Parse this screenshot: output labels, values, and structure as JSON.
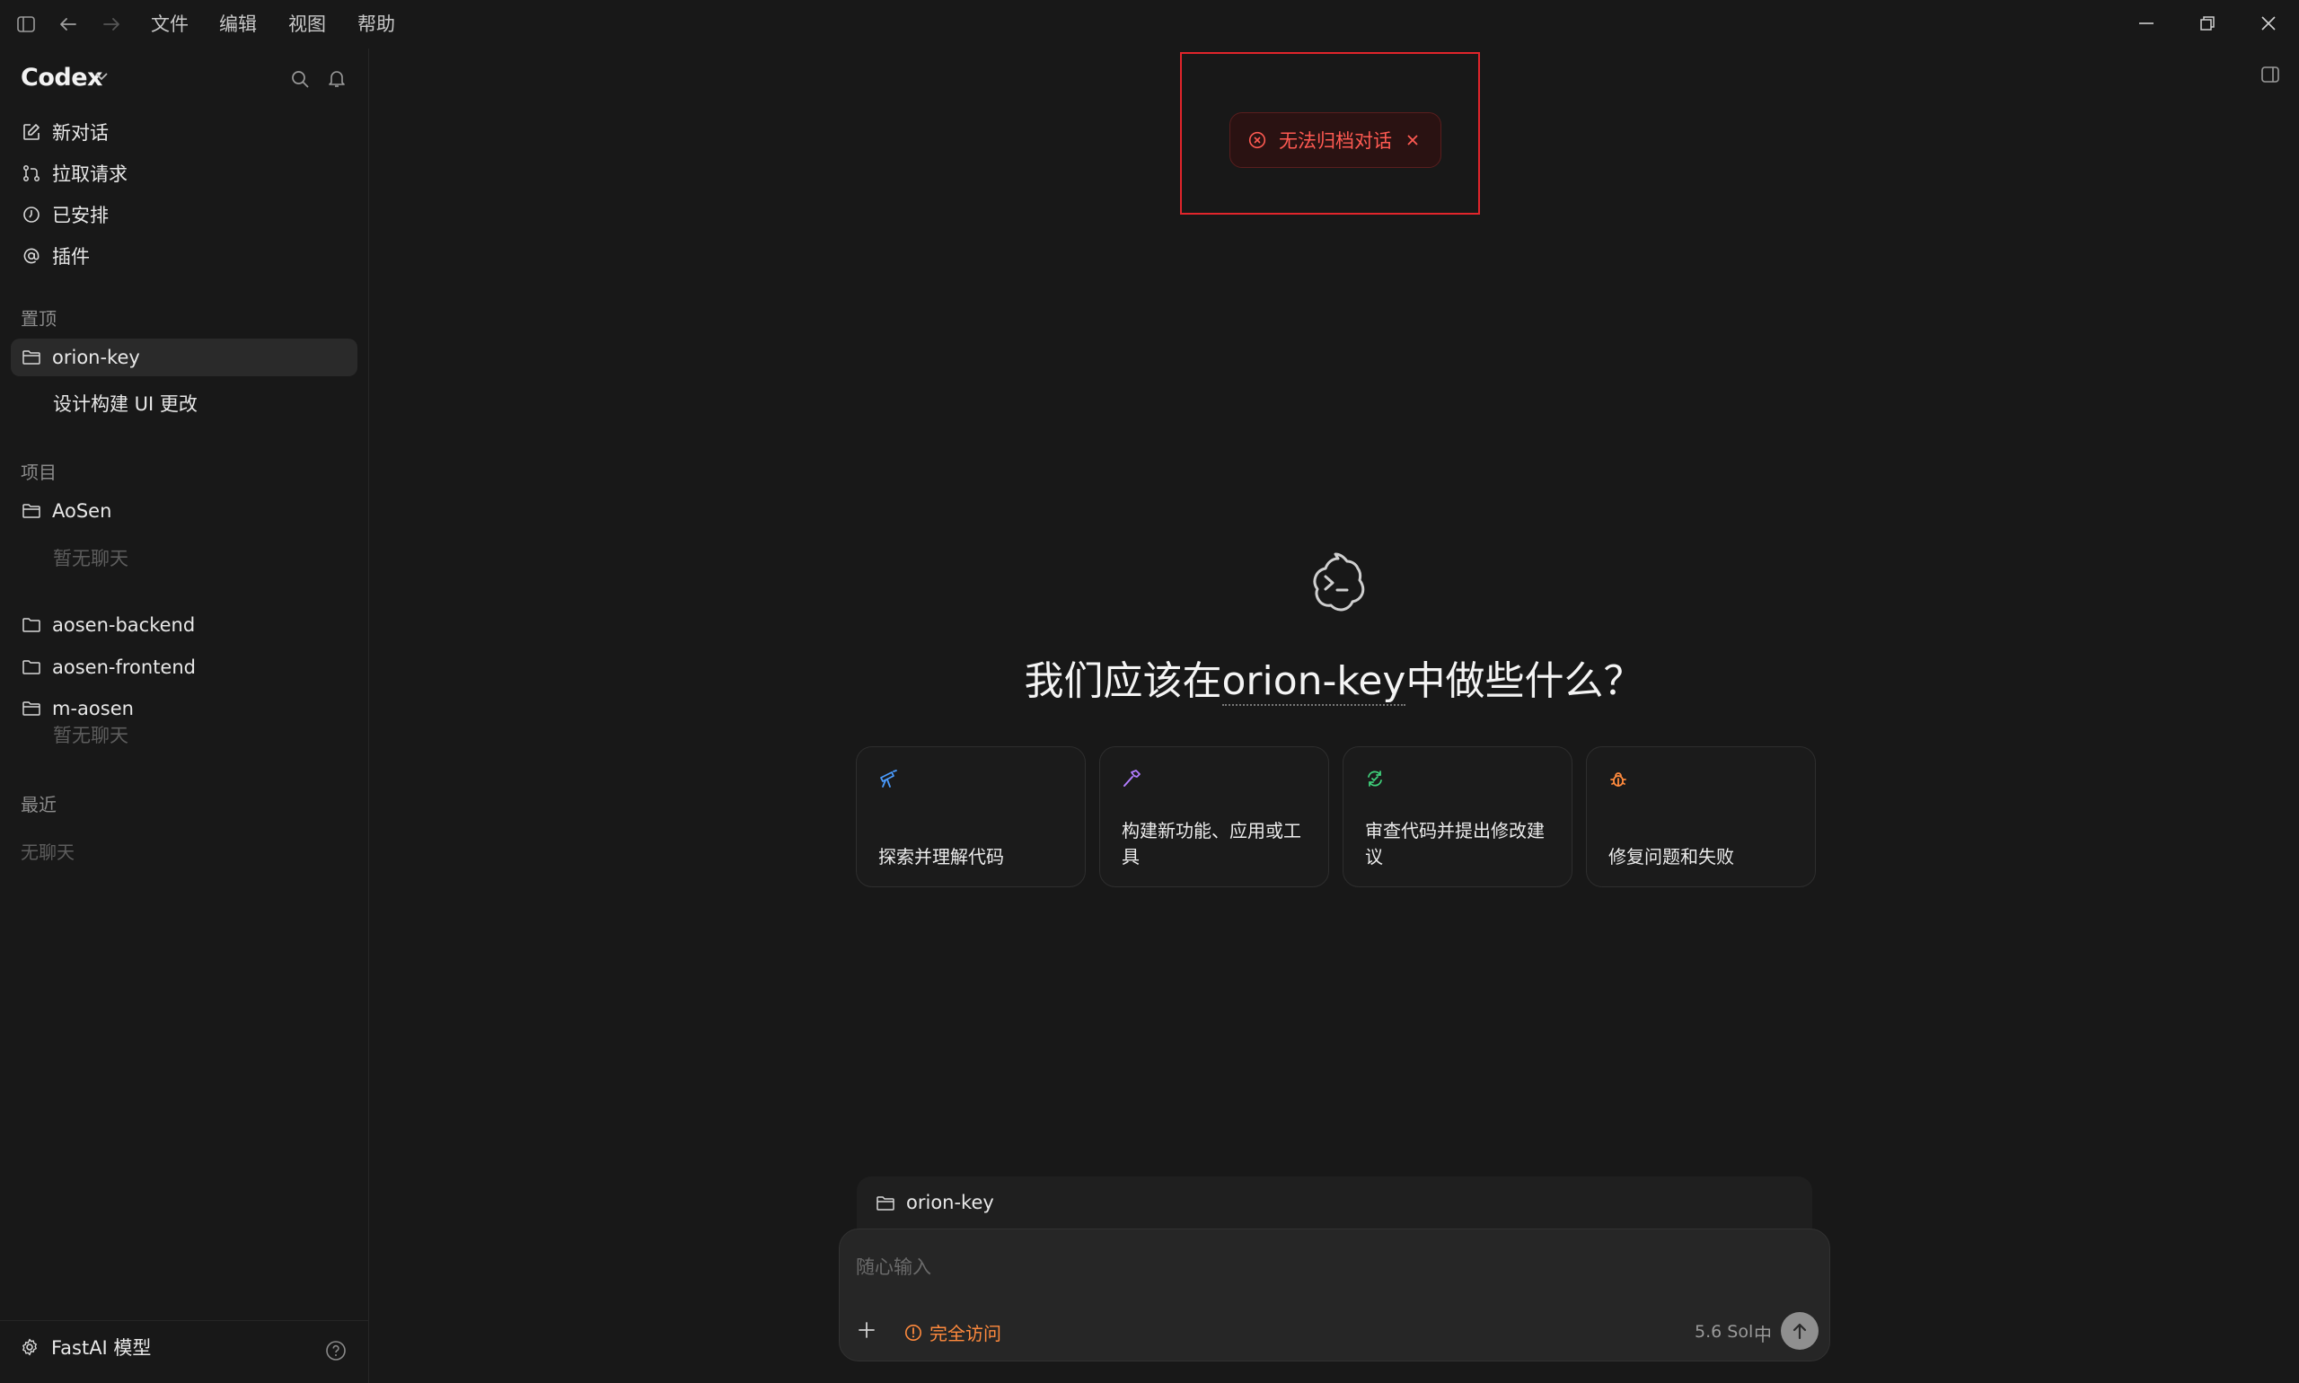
{
  "titlebar": {
    "menus": [
      "文件",
      "编辑",
      "视图",
      "帮助"
    ]
  },
  "sidebar": {
    "brand": "Codex",
    "nav": [
      {
        "label": "新对话",
        "icon": "edit-icon"
      },
      {
        "label": "拉取请求",
        "icon": "pull-request-icon"
      },
      {
        "label": "已安排",
        "icon": "clock-icon"
      },
      {
        "label": "插件",
        "icon": "at-icon"
      }
    ],
    "pinned": {
      "label": "置顶",
      "project": "orion-key",
      "chat": "设计构建 UI 更改"
    },
    "projects": {
      "label": "项目",
      "items": [
        {
          "name": "AoSen",
          "empty": "暂无聊天"
        },
        {
          "name": "aosen-backend"
        },
        {
          "name": "aosen-frontend"
        },
        {
          "name": "m-aosen",
          "empty": "暂无聊天"
        }
      ]
    },
    "recent": {
      "label": "最近",
      "empty": "无聊天"
    },
    "footer": {
      "label": "FastAI 模型"
    }
  },
  "toast": {
    "message": "无法归档对话"
  },
  "hero": {
    "prefix": "我们应该在",
    "project": "orion-key",
    "suffix": "中做些什么？"
  },
  "cards": [
    {
      "label": "探索并理解代码",
      "icon": "telescope-icon",
      "color": "#4a9cff"
    },
    {
      "label": "构建新功能、应用或工具",
      "icon": "hammer-icon",
      "color": "#b27cff"
    },
    {
      "label": "审查代码并提出修改建议",
      "icon": "review-icon",
      "color": "#3fcf7a"
    },
    {
      "label": "修复问题和失败",
      "icon": "bug-icon",
      "color": "#ff8a3d"
    }
  ],
  "composer": {
    "project": "orion-key",
    "placeholder": "随心输入",
    "access": "完全访问",
    "model": "5.6 Sol",
    "ime": "中"
  },
  "colors": {
    "accent_error": "#ff5a52",
    "accent_warning": "#ff8a3d",
    "background": "#181818"
  }
}
